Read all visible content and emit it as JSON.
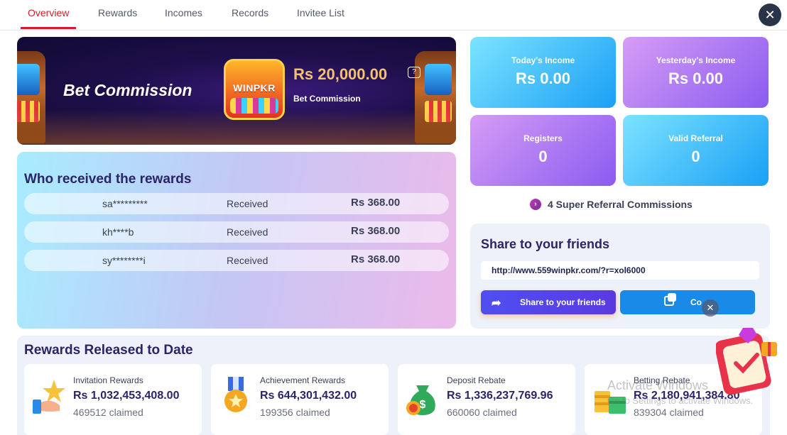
{
  "tabs": [
    {
      "label": "Overview",
      "active": true
    },
    {
      "label": "Rewards"
    },
    {
      "label": "Incomes"
    },
    {
      "label": "Records"
    },
    {
      "label": "Invitee List"
    }
  ],
  "close_icon": "close-icon",
  "banner": {
    "title": "Bet Commission",
    "logo_text": "WINPKR",
    "amount": "Rs  20,000.00",
    "subtitle": "Bet Commission"
  },
  "stats": [
    {
      "label": "Today's Income",
      "value": "Rs  0.00",
      "color": "#1aa0f5"
    },
    {
      "label": "Yesterday's Income",
      "value": "Rs  0.00",
      "color": "#8a5cf0"
    },
    {
      "label": "Registers",
      "value": "0",
      "color": "#8a5cf0"
    },
    {
      "label": "Valid Referral",
      "value": "0",
      "color": "#1aa0f5"
    }
  ],
  "who": {
    "title": "Who received the rewards",
    "rows": [
      {
        "name": "sa*********",
        "status": "Received",
        "amount": "Rs  368.00"
      },
      {
        "name": "kh****b",
        "status": "Received",
        "amount": "Rs  368.00"
      },
      {
        "name": "sy********i",
        "status": "Received",
        "amount": "Rs  368.00"
      }
    ]
  },
  "super_referral": "4 Super Referral Commissions",
  "share": {
    "title": "Share to your friends",
    "url": "http://www.559winpkr.com/?r=xol6000",
    "share_button": "Share to your friends",
    "copy_button": "Co"
  },
  "released": {
    "title": "Rewards Released to Date",
    "cards": [
      {
        "label": "Invitation Rewards",
        "value": "Rs  1,032,453,408.00",
        "claimed": "469512 claimed",
        "icon": "star-hand-icon"
      },
      {
        "label": "Achievement Rewards",
        "value": "Rs  644,301,432.00",
        "claimed": "199356 claimed",
        "icon": "medal-icon"
      },
      {
        "label": "Deposit Rebate",
        "value": "Rs  1,336,237,769.96",
        "claimed": "660060 claimed",
        "icon": "money-bag-icon"
      },
      {
        "label": "Betting Rebate",
        "value": "Rs  2,180,941,384.80",
        "claimed": "839304 claimed",
        "icon": "cash-stack-icon"
      }
    ]
  },
  "watermark": {
    "line1": "Activate Windows",
    "line2": "Go to Settings to activate Windows."
  }
}
